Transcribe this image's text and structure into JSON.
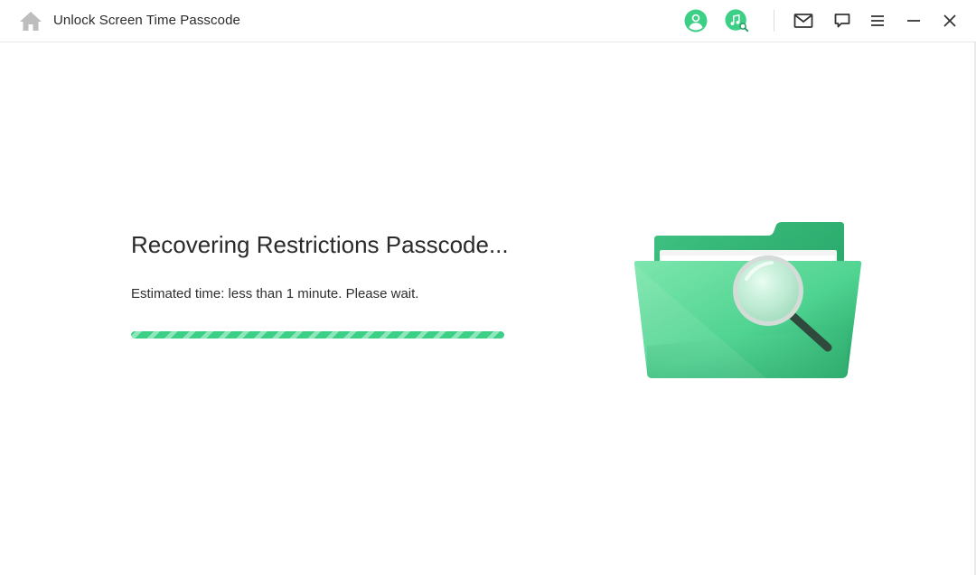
{
  "window": {
    "title": "Unlock Screen Time Passcode"
  },
  "toolbar": {
    "icons": [
      "home-icon",
      "account-icon",
      "music-search-icon",
      "mail-icon",
      "feedback-icon",
      "menu-icon",
      "minimize-icon",
      "close-icon"
    ]
  },
  "main": {
    "heading": "Recovering Restrictions Passcode...",
    "subtext": "Estimated time: less than 1 minute. Please wait.",
    "progress": 1.0
  },
  "colors": {
    "accent": "#3ccf86",
    "accent_dark": "#1f9d5f",
    "progress_track": "#c9f0dc"
  }
}
